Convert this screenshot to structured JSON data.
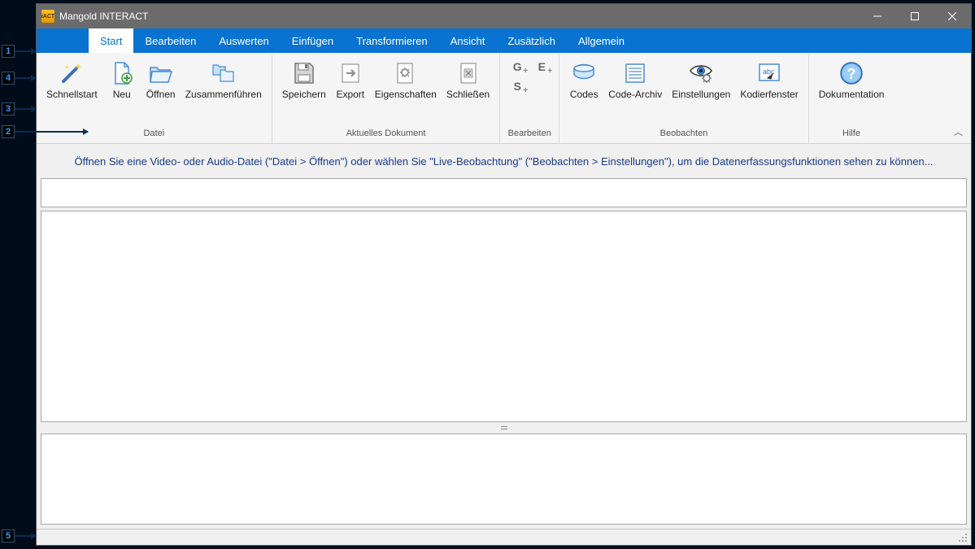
{
  "window": {
    "title": "Mangold INTERACT"
  },
  "annotations": [
    "1",
    "2",
    "3",
    "4",
    "5"
  ],
  "tabs": [
    {
      "label": "Start",
      "active": true
    },
    {
      "label": "Bearbeiten"
    },
    {
      "label": "Auswerten"
    },
    {
      "label": "Einfügen"
    },
    {
      "label": "Transformieren"
    },
    {
      "label": "Ansicht"
    },
    {
      "label": "Zusätzlich"
    },
    {
      "label": "Allgemein"
    }
  ],
  "ribbon": {
    "groups": {
      "datei": {
        "label": "Datei",
        "items": {
          "schnellstart": "Schnellstart",
          "neu": "Neu",
          "oeffnen": "Öffnen",
          "zusammen": "Zusammenführen"
        }
      },
      "aktuelles": {
        "label": "Aktuelles Dokument",
        "items": {
          "speichern": "Speichern",
          "export": "Export",
          "eigenschaften": "Eigenschaften",
          "schliessen": "Schließen"
        }
      },
      "bearbeiten": {
        "label": "Bearbeiten",
        "mini": {
          "g": "G",
          "e": "E",
          "s": "S"
        }
      },
      "beobachten": {
        "label": "Beobachten",
        "items": {
          "codes": "Codes",
          "archiv": "Code-Archiv",
          "einstellungen": "Einstellungen",
          "kodier": "Kodierfenster"
        }
      },
      "hilfe": {
        "label": "Hilfe",
        "items": {
          "doku": "Dokumentation"
        }
      }
    }
  },
  "hint": "Öffnen Sie eine Video- oder Audio-Datei (\"Datei > Öffnen\") oder wählen Sie \"Live-Beobachtung\" (\"Beobachten > Einstellungen\"), um die Datenerfassungsfunktionen sehen zu können..."
}
